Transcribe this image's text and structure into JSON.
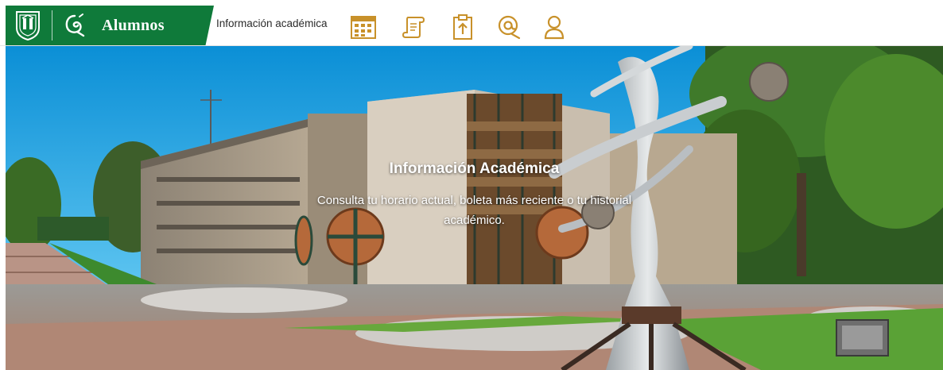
{
  "header": {
    "brand_title": "Alumnos",
    "section_label": "Información académica",
    "colors": {
      "brand_green": "#0f7a3a",
      "icon_gold": "#c8912a"
    },
    "nav_icons": [
      "schedule-icon",
      "scroll-icon",
      "clipboard-icon",
      "email-icon",
      "user-icon"
    ]
  },
  "hero": {
    "title": "Información Académica",
    "subtitle": "Consulta tu horario actual, boleta más reciente o tu historial académico."
  }
}
